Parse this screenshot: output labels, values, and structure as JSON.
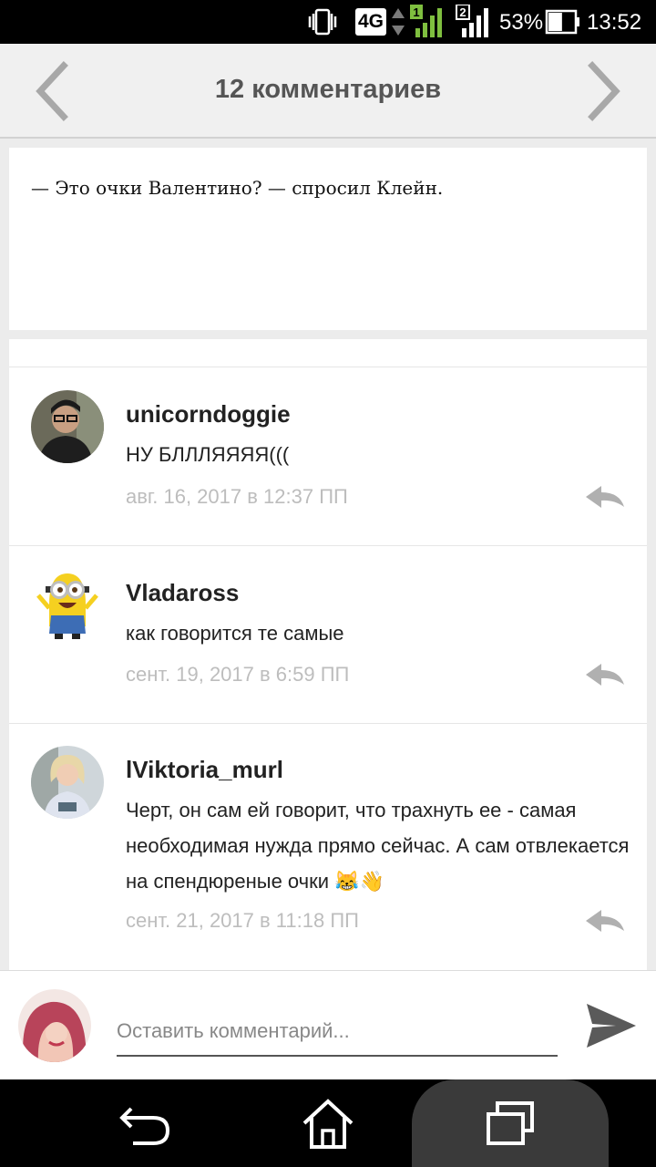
{
  "status_bar": {
    "network": "4G",
    "sim1": "1",
    "sim2": "2",
    "battery_percent": "53%",
    "battery_level": 0.53,
    "time": "13:52"
  },
  "header": {
    "title": "12 комментариев"
  },
  "post": {
    "quote": "— Это очки Валентино? — спросил Клейн."
  },
  "comments": [
    {
      "username": "unicorndoggie",
      "text": "НУ БЛЛЛЯЯЯЯ(((",
      "date": "авг. 16, 2017 в 12:37 ПП"
    },
    {
      "username": "Vladaross",
      "text": "как говорится те самые",
      "date": "сент. 19, 2017 в 6:59 ПП"
    },
    {
      "username": "lViktoria_murl",
      "text": "Черт, он сам ей говорит, что трахнуть ее - самая необходимая нужда прямо сейчас. А сам отвлекается на спендюреные очки 😹👋",
      "date": "сент. 21, 2017 в 11:18 ПП"
    }
  ],
  "comment_input": {
    "placeholder": "Оставить комментарий...",
    "value": ""
  },
  "colors": {
    "header_bg": "#f0f0f0",
    "title": "#555555",
    "date": "#bdbdbd",
    "icon_gray": "#a8a8a8"
  }
}
